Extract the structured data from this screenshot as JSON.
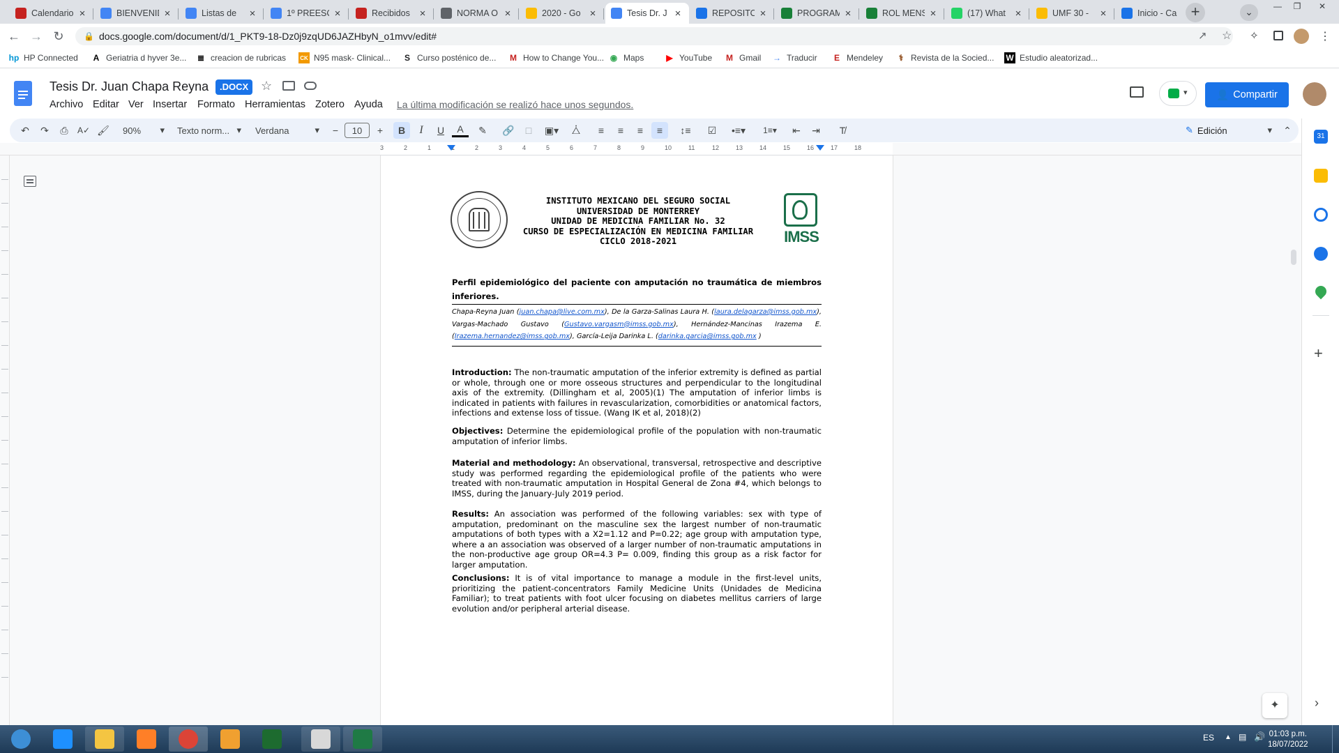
{
  "browser": {
    "tabs": [
      {
        "title": "Calendario",
        "icon": "gmail-icon",
        "color": "#c5221f",
        "active": false
      },
      {
        "title": "BIENVENID",
        "icon": "docs-icon",
        "color": "#4285f4",
        "active": false
      },
      {
        "title": "Listas de",
        "icon": "docs-icon",
        "color": "#4285f4",
        "active": false
      },
      {
        "title": "1º PREESC",
        "icon": "docs-icon",
        "color": "#4285f4",
        "active": false
      },
      {
        "title": "Recibidos",
        "icon": "gmail-icon",
        "color": "#c5221f",
        "active": false
      },
      {
        "title": "NORMA O",
        "icon": "globe-icon",
        "color": "#5f6368",
        "active": false
      },
      {
        "title": "2020 - Go",
        "icon": "drive-icon",
        "color": "#fbbc04",
        "active": false
      },
      {
        "title": "Tesis Dr. J",
        "icon": "docs-icon",
        "color": "#4285f4",
        "active": true
      },
      {
        "title": "REPOSITO",
        "icon": "chrome-page-icon",
        "color": "#1a73e8",
        "active": false
      },
      {
        "title": "PROGRAM",
        "icon": "sheets-icon",
        "color": "#188038",
        "active": false
      },
      {
        "title": "ROL MENS",
        "icon": "sheets-icon",
        "color": "#188038",
        "active": false
      },
      {
        "title": "(17) What",
        "icon": "whatsapp-icon",
        "color": "#25d366",
        "active": false
      },
      {
        "title": "UMF 30 -",
        "icon": "drive-icon",
        "color": "#fbbc04",
        "active": false
      },
      {
        "title": "Inicio - Ca",
        "icon": "chrome-page-icon",
        "color": "#1a73e8",
        "active": false
      }
    ],
    "new_tab_symbol": "+",
    "url": "docs.google.com/document/d/1_PKT9-18-Dz0j9zqUD6JAZHbyN_o1mvv/edit#",
    "bookmarks": [
      {
        "label": "HP Connected",
        "icon": "hp-icon"
      },
      {
        "label": "Geriatria d hyver 3e...",
        "icon": "a-icon"
      },
      {
        "label": "creacion de rubricas",
        "icon": "rubric-icon"
      },
      {
        "label": "N95 mask- Clinical...",
        "icon": "ck-icon"
      },
      {
        "label": "Curso posténico de...",
        "icon": "s-icon"
      },
      {
        "label": "How to Change You...",
        "icon": "gmail-icon"
      },
      {
        "label": "Maps",
        "icon": "maps-icon"
      },
      {
        "label": "YouTube",
        "icon": "youtube-icon"
      },
      {
        "label": "Gmail",
        "icon": "gmail-icon"
      },
      {
        "label": "Traducir",
        "icon": "translate-icon"
      },
      {
        "label": "Mendeley",
        "icon": "mendeley-icon"
      },
      {
        "label": "Revista de la Socied...",
        "icon": "caduceus-icon"
      },
      {
        "label": "Estudio aleatorizad...",
        "icon": "w-icon"
      }
    ]
  },
  "docs": {
    "title": "Tesis Dr. Juan Chapa Reyna",
    "badge": ".DOCX",
    "menu": [
      "Archivo",
      "Editar",
      "Ver",
      "Insertar",
      "Formato",
      "Herramientas",
      "Zotero",
      "Ayuda"
    ],
    "last_edit": "La última modificación se realizó hace unos segundos.",
    "share_label": "Compartir",
    "toolbar": {
      "zoom": "90%",
      "style": "Texto norm...",
      "font": "Verdana",
      "font_size": "10",
      "mode": "Edición"
    },
    "ruler_numbers": [
      "3",
      "2",
      "1",
      "1",
      "2",
      "3",
      "4",
      "5",
      "6",
      "7",
      "8",
      "9",
      "10",
      "11",
      "12",
      "13",
      "14",
      "15",
      "16",
      "17",
      "18"
    ]
  },
  "document": {
    "header_lines": [
      "INSTITUTO MEXICANO DEL SEGURO SOCIAL",
      "UNIVERSIDAD DE MONTERREY",
      "UNIDAD DE MEDICINA FAMILIAR No. 32",
      "CURSO DE ESPECIALIZACIÓN EN MEDICINA FAMILIAR",
      "CICLO 2018-2021"
    ],
    "logo_left_text": "UNIVERSIDAD DE MONTERREY",
    "logo_right_text": "IMSS",
    "title": "Perfil epidemiológico del paciente con amputación no traumática de miembros inferiores.",
    "authors": [
      {
        "name": "Chapa-Reyna Juan",
        "email": "juan.chapa@live.com.mx"
      },
      {
        "name": "De la Garza-Salinas Laura H.",
        "email": "laura.delagarza@imss.gob.mx"
      },
      {
        "name": "Vargas-Machado Gustavo",
        "email": "Gustavo.vargasm@imss.gob.mx"
      },
      {
        "name": "Hernández-Mancinas Irazema E.",
        "email": "Irazema.hernandez@imss.gob.mx"
      },
      {
        "name": "García-Leija Darinka L.",
        "email": "darinka.garcia@imss.gob.mx"
      }
    ],
    "sections": [
      {
        "heading": "Introduction:",
        "text": "The non-traumatic amputation of the inferior extremity is defined as partial or whole, through one or more osseous structures and perpendicular to the longitudinal axis of the extremity. (Dillingham et al, 2005)(1) The amputation of inferior limbs is indicated in patients with failures in revascularization, comorbidities or anatomical factors, infections and extense loss of tissue. (Wang IK et al, 2018)(2)"
      },
      {
        "heading": "Objectives:",
        "text": "Determine the epidemiological profile of the population with non-traumatic amputation of inferior limbs."
      },
      {
        "heading": "Material and methodology:",
        "text": "An observational, transversal, retrospective and descriptive study was performed regarding the epidemiological profile of the patients who were treated with non-traumatic amputation in Hospital General de Zona #4, which belongs to IMSS, during the January-July 2019 period."
      },
      {
        "heading": "Results:",
        "text": "An association was performed of the following variables: sex with type of amputation, predominant on the masculine sex the largest number of non-traumatic amputations of both types with a X2=1.12 and P=0.22; age group with amputation type, where a an association was observed of a larger number of non-traumatic amputations in the non-productive age group OR=4.3 P= 0.009, finding this group as a risk factor for larger amputation."
      },
      {
        "heading": "Conclusions:",
        "text": "It is of vital importance to manage a module in the first-level units, prioritizing the patient-concentrators Family Medicine Units (Unidades de Medicina Familiar); to treat patients with foot ulcer focusing on diabetes mellitus carriers of large evolution and/or peripheral arterial disease."
      }
    ]
  },
  "taskbar": {
    "language": "ES",
    "time": "01:03 p.m.",
    "date": "18/07/2022",
    "apps": [
      "windows-start-icon",
      "internet-explorer-icon",
      "file-explorer-icon",
      "media-player-icon",
      "chrome-icon",
      "outlook-icon",
      "kenya-flag-icon",
      "pdf-icon",
      "excel-icon"
    ]
  },
  "colors": {
    "accent": "#1a73e8",
    "tabstrip": "#dee1e6",
    "toolbar": "#edf2fa",
    "taskbar": "#2b4a6a"
  }
}
